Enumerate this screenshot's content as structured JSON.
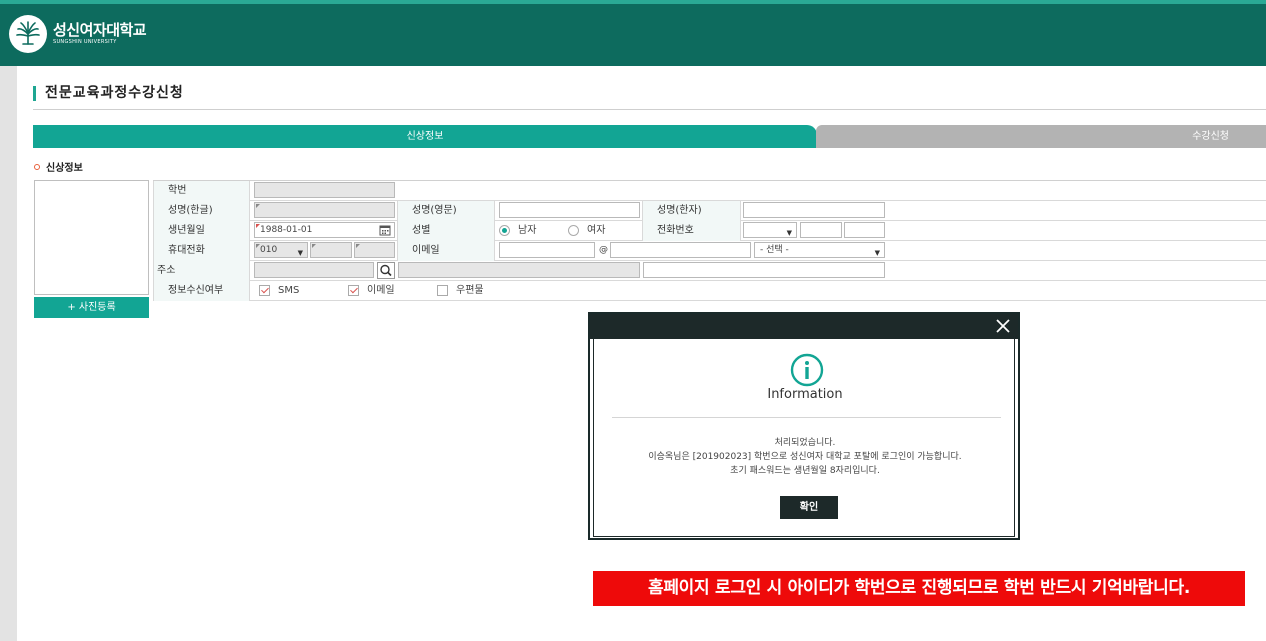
{
  "header": {
    "logo_kr": "성신여자대학교",
    "logo_en": "SUNGSHIN UNIVERSITY"
  },
  "page": {
    "title": "전문교육과정수강신청"
  },
  "tabs": [
    {
      "label": "신상정보",
      "active": true
    },
    {
      "label": "수강신청",
      "active": false
    }
  ],
  "section": {
    "title": "신상정보",
    "photo_button": "+ 사진등록"
  },
  "form": {
    "student_id_label": "학번",
    "student_id_value": "",
    "name_kr_label": "성명(한글)",
    "name_kr_value": "",
    "name_en_label": "성명(영문)",
    "name_en_value": "",
    "name_hanja_label": "성명(한자)",
    "name_hanja_value": "",
    "birth_label": "생년월일",
    "birth_value": "1988-01-01",
    "gender_label": "성별",
    "gender_male": "남자",
    "gender_female": "여자",
    "gender_selected": "남자",
    "phone_label": "전화번호",
    "mobile_label": "휴대전화",
    "mobile_prefix": "010",
    "email_label": "이메일",
    "email_at": "@",
    "email_domain_select": "- 선택 -",
    "address_label": "주소",
    "consent_label": "정보수신여부",
    "consent_sms": "SMS",
    "consent_email": "이메일",
    "consent_post": "우편물",
    "consent_sms_checked": true,
    "consent_email_checked": true,
    "consent_post_checked": false
  },
  "modal": {
    "title": "Information",
    "line1": "처리되었습니다.",
    "line2": "이승옥님은 [201902023] 학번으로 성신여자 대학교 포탈에 로그인이 가능합니다.",
    "line3": "초기 패스워드는 생년월일 8자리입니다.",
    "ok_button": "확인"
  },
  "notice": {
    "text": "홈페이지 로그인 시 아이디가 학번으로 진행되므로 학번 반드시 기억바랍니다."
  },
  "colors": {
    "header_bg": "#0d6b5e",
    "accent": "#12a594",
    "notice_bg": "#ee0a0a",
    "modal_dark": "#1d2929"
  }
}
